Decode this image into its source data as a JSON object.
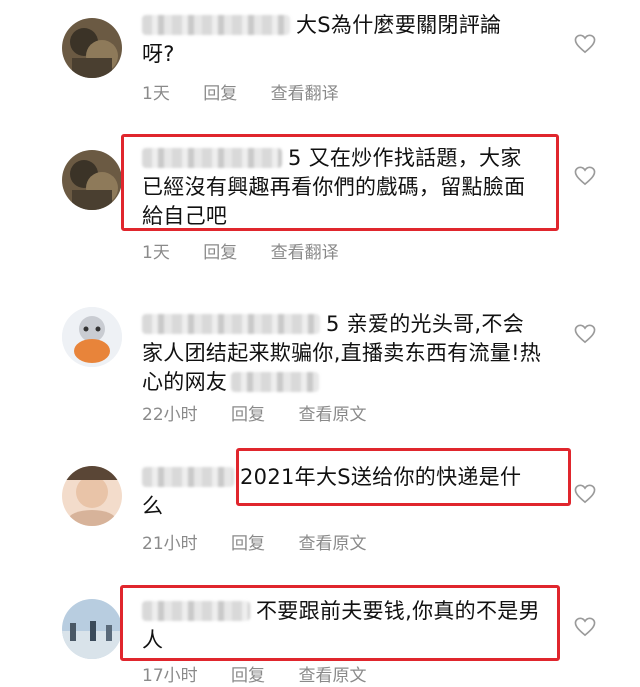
{
  "comments": [
    {
      "name_suffix": "大S為什麼要關閉評論",
      "text": "呀?",
      "time": "1天",
      "reply": "回复",
      "translate": "查看翻译"
    },
    {
      "name_suffix": "5 又在炒作找話題，大家",
      "text": "已經沒有興趣再看你們的戲碼，留點臉面給自己吧",
      "time": "1天",
      "reply": "回复",
      "translate": "查看翻译"
    },
    {
      "name_suffix": "5 亲爱的光头哥,不会",
      "text": "家人团结起来欺骗你,直播卖东西有流量!热心的网友",
      "time": "22小时",
      "reply": "回复",
      "translate": "查看原文"
    },
    {
      "name_suffix": "2021年大S送给你的快递是什",
      "text": "么",
      "time": "21小时",
      "reply": "回复",
      "translate": "查看原文"
    },
    {
      "name_suffix": "不要跟前夫要钱,你真的不是男",
      "text": "人",
      "time": "17小时",
      "reply": "回复",
      "translate": "查看原文"
    }
  ],
  "colors": {
    "highlight": "#e0262d",
    "meta": "#8a8a8a",
    "heart": "#9a9a9a"
  },
  "icons": {
    "like": "heart-outline-icon"
  }
}
